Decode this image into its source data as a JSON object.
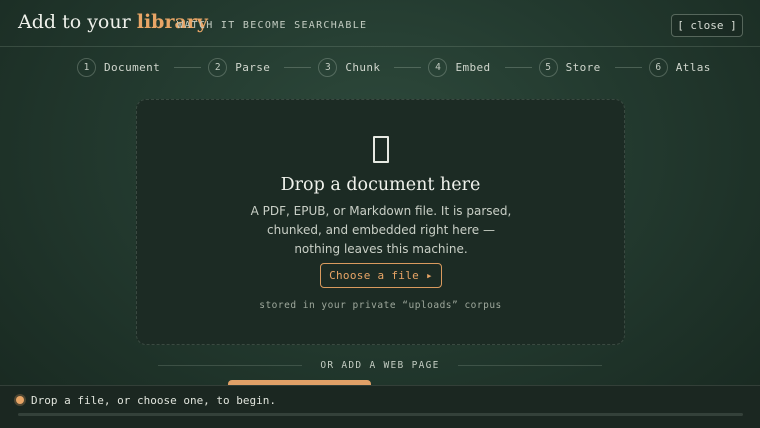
{
  "header": {
    "title_prefix": "Add to your ",
    "title_accent": "library",
    "subtitle": "WATCH IT BECOME SEARCHABLE",
    "close_label": "[ close ]"
  },
  "steps": [
    {
      "num": "1",
      "label": "Document"
    },
    {
      "num": "2",
      "label": "Parse"
    },
    {
      "num": "3",
      "label": "Chunk"
    },
    {
      "num": "4",
      "label": "Embed"
    },
    {
      "num": "5",
      "label": "Store"
    },
    {
      "num": "6",
      "label": "Atlas"
    }
  ],
  "dropzone": {
    "icon": "document-icon",
    "title": "Drop a document here",
    "description": "A PDF, EPUB, or Markdown file. It is parsed, chunked, and embedded right here — nothing leaves this machine.",
    "choose_label": "Choose a file ▸",
    "note": "stored in your private “uploads” corpus"
  },
  "divider": {
    "label": "OR ADD A WEB PAGE"
  },
  "status": {
    "text": "Drop a file, or choose one, to begin.",
    "progress": 0
  },
  "colors": {
    "accent": "#e8a566",
    "background": "#233a2f",
    "panel": "#1c2b24"
  }
}
